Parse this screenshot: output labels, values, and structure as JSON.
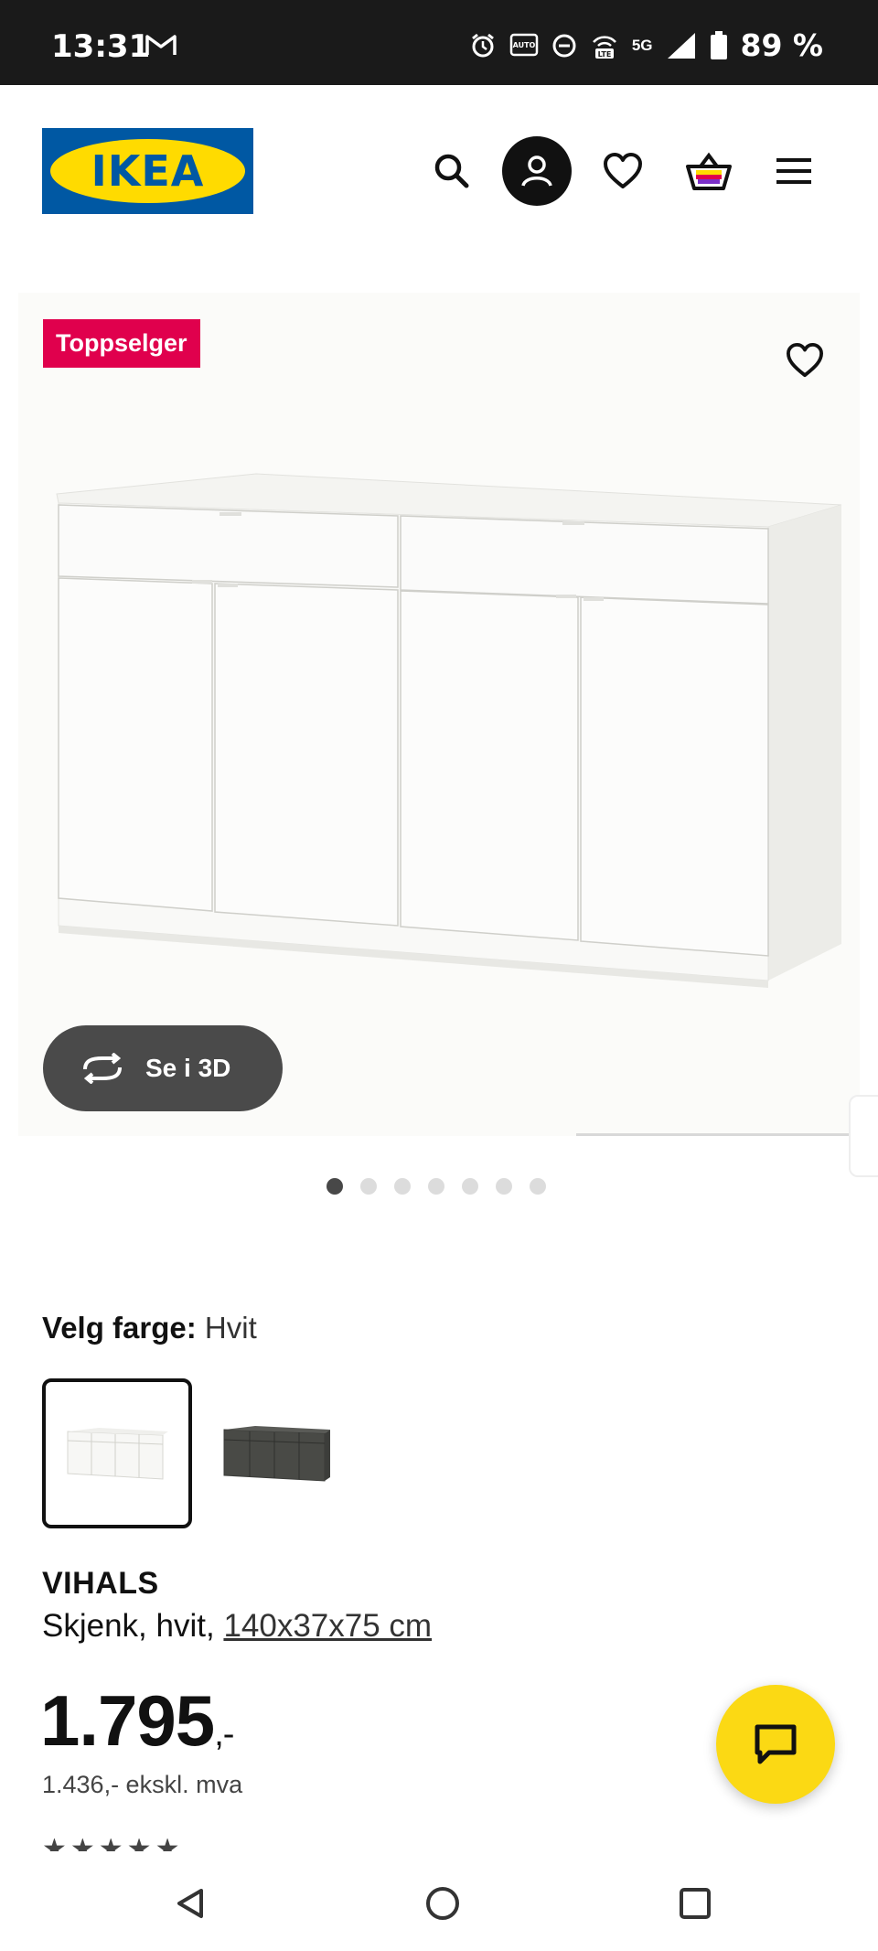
{
  "status_bar": {
    "time": "13:31",
    "network": "5G",
    "battery": "89 %"
  },
  "header": {
    "logo_text": "IKEA",
    "icons": [
      "search-icon",
      "profile-icon",
      "heart-icon",
      "basket-icon",
      "menu-icon"
    ]
  },
  "gallery": {
    "badge": "Toppselger",
    "view_3d_label": "Se i 3D",
    "image_count": 7,
    "active_image": 1
  },
  "color_picker": {
    "label": "Velg farge:",
    "selected_value": "Hvit",
    "options": [
      "white",
      "dark-grey"
    ]
  },
  "product": {
    "name": "VIHALS",
    "description_prefix": "Skjenk, hvit,",
    "dimensions": "140x37x75 cm",
    "price": "1.795",
    "price_suffix": ",-",
    "price_ex_vat": "1.436,- ekskl. mva"
  },
  "colors": {
    "brand_blue": "#0058a3",
    "brand_yellow": "#ffdb00",
    "badge_red": "#e0004d",
    "chat_yellow": "#fbd914"
  }
}
